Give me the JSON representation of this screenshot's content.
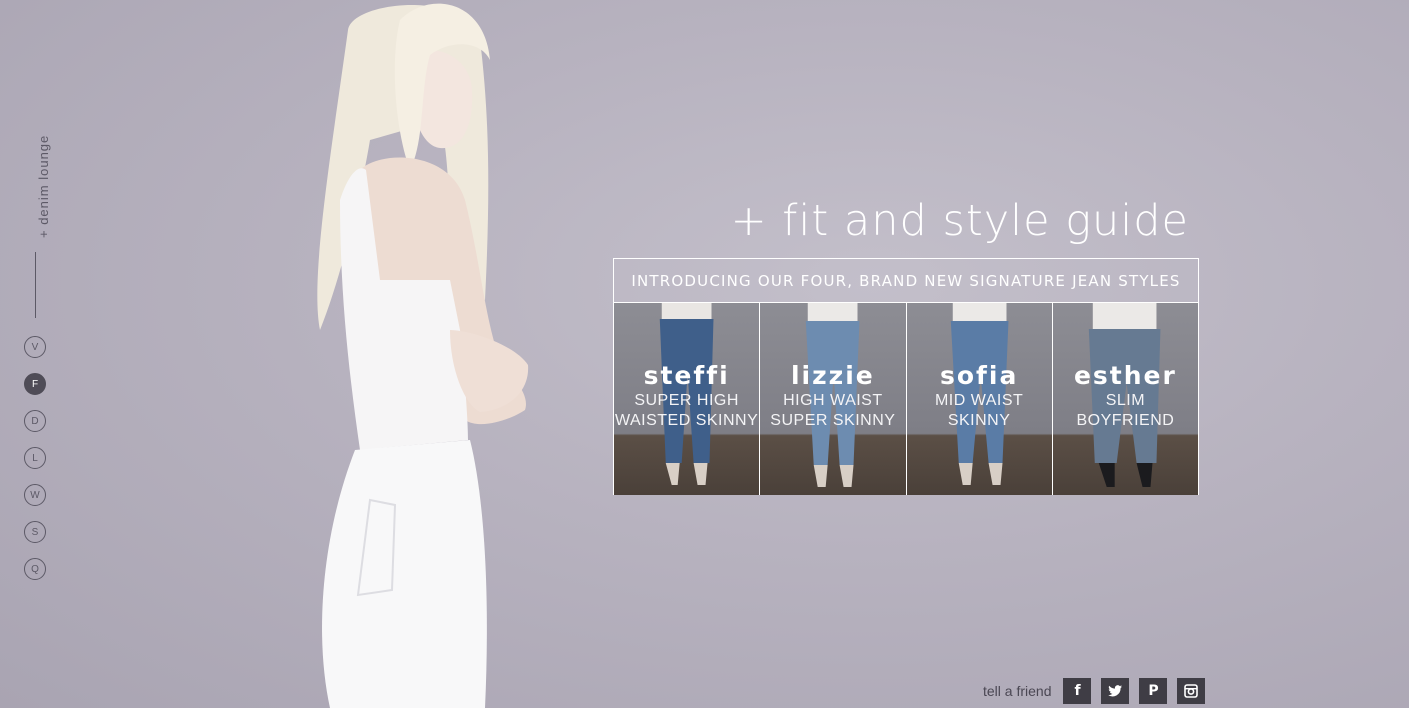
{
  "sidebar": {
    "label": "+ denim lounge",
    "nav": [
      {
        "letter": "V",
        "active": false
      },
      {
        "letter": "F",
        "active": true
      },
      {
        "letter": "D",
        "active": false
      },
      {
        "letter": "L",
        "active": false
      },
      {
        "letter": "W",
        "active": false
      },
      {
        "letter": "S",
        "active": false
      },
      {
        "letter": "Q",
        "active": false
      }
    ]
  },
  "title": "+ fit and style guide",
  "guide": {
    "header": "INTRODUCING OUR FOUR, BRAND NEW SIGNATURE JEAN STYLES",
    "styles": [
      {
        "name": "steffi",
        "desc": "SUPER HIGH\nWAISTED SKINNY"
      },
      {
        "name": "lizzie",
        "desc": "HIGH WAIST\nSUPER SKINNY"
      },
      {
        "name": "sofia",
        "desc": "MID WAIST\nSKINNY"
      },
      {
        "name": "esther",
        "desc": "SLIM\nBOYFRIEND"
      }
    ]
  },
  "share": {
    "label": "tell a friend",
    "icons": [
      "facebook-icon",
      "twitter-icon",
      "pinterest-icon",
      "instagram-icon"
    ],
    "facebook_glyph": "f",
    "pinterest_glyph": "P"
  },
  "colors": {
    "background": "#b9b4c1",
    "nav_active": "#4f4c57",
    "social_bg": "#3f3d45"
  }
}
